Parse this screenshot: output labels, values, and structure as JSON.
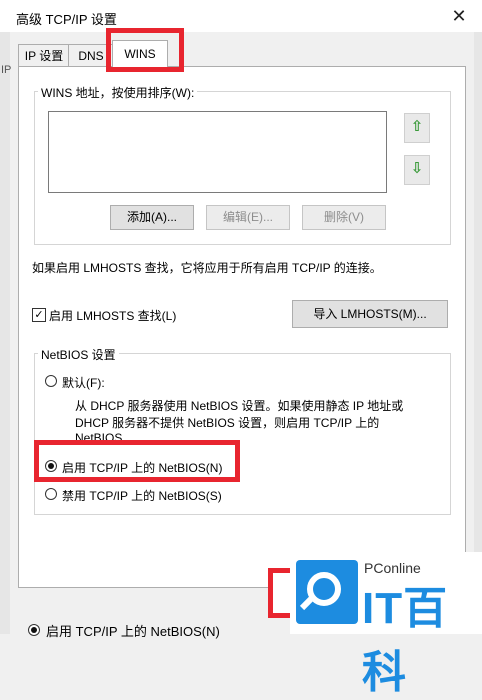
{
  "window": {
    "title": "高级 TCP/IP 设置",
    "close_glyph": "✕"
  },
  "tabs": [
    {
      "label": "IP 设置"
    },
    {
      "label": "DNS"
    },
    {
      "label": "WINS"
    }
  ],
  "wins_group": {
    "label": "WINS 地址，按使用排序(W):",
    "up_glyph": "⇧",
    "down_glyph": "⇩",
    "add_label": "添加(A)...",
    "edit_label": "编辑(E)...",
    "delete_label": "删除(V)"
  },
  "lmhosts": {
    "info": "如果启用 LMHOSTS 查找，它将应用于所有启用 TCP/IP 的连接。",
    "checkbox_label": "启用 LMHOSTS 查找(L)",
    "checked": true,
    "import_label": "导入 LMHOSTS(M)..."
  },
  "netbios": {
    "legend": "NetBIOS 设置",
    "default_label": "默认(F):",
    "default_desc_1": "从 DHCP 服务器使用 NetBIOS 设置。如果使用静态 IP 地址或",
    "default_desc_2": "DHCP 服务器不提供 NetBIOS 设置，则启用 TCP/IP 上的",
    "default_desc_3": "NetBIOS",
    "enable_label": "启用 TCP/IP 上的 NetBIOS(N)",
    "disable_label": "禁用 TCP/IP 上的 NetBIOS(S)",
    "selected": "enable"
  },
  "background_strip": {
    "left_glyph": "IP",
    "bottom_text": "启用 TCP/IP 上的 NetBIOS(N)"
  },
  "watermark": {
    "sub": "PConline",
    "brand": "IT百科"
  },
  "colors": {
    "highlight": "#e8252f",
    "brand_blue": "#1d8ce0",
    "arrow_green": "#3a9a3a"
  }
}
